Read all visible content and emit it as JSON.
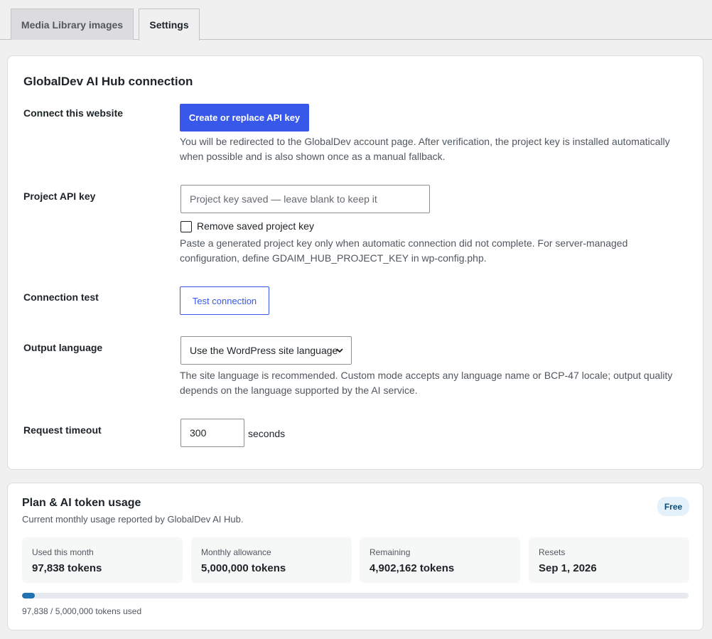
{
  "tabs": [
    {
      "label": "Media Library images",
      "active": false
    },
    {
      "label": "Settings",
      "active": true
    }
  ],
  "connection": {
    "title": "GlobalDev AI Hub connection",
    "connect_label": "Connect this website",
    "connect_button": "Create or replace API key",
    "connect_desc_line1": "You will be redirected to the GlobalDev account page. After verification, the project key is installed automatically",
    "connect_desc_line2": "when possible and is also shown once as a manual fallback.",
    "api_key_label": "Project API key",
    "api_key_placeholder": "Project key saved — leave blank to keep it",
    "api_key_value": "",
    "remove_key_label": "Remove saved project key",
    "remove_key_checked": false,
    "api_key_desc_line1": "Paste a generated project key only when automatic connection did not complete. For server-managed",
    "api_key_desc_line2": "configuration, define GDAIM_HUB_PROJECT_KEY in wp-config.php.",
    "test_label": "Connection test",
    "test_button": "Test connection",
    "language_label": "Output language",
    "language_selected": "Use the WordPress site language",
    "language_desc_line1": "The site language is recommended. Custom mode accepts any language name or BCP-47 locale; output quality",
    "language_desc_line2": "depends on the language supported by the AI service.",
    "timeout_label": "Request timeout",
    "timeout_value": "300",
    "timeout_unit": "seconds"
  },
  "usage": {
    "title": "Plan & AI token usage",
    "subtitle": "Current monthly usage reported by GlobalDev AI Hub.",
    "plan_badge": "Free",
    "stats": [
      {
        "label": "Used this month",
        "value": "97,838 tokens"
      },
      {
        "label": "Monthly allowance",
        "value": "5,000,000 tokens"
      },
      {
        "label": "Remaining",
        "value": "4,902,162 tokens"
      },
      {
        "label": "Resets",
        "value": "Sep 1, 2026"
      }
    ],
    "progress_fraction": 0.0196,
    "progress_text": "97,838 / 5,000,000 tokens used"
  },
  "colors": {
    "primary": "#3858e9",
    "progress": "#2271b1",
    "badge_bg": "#e5f1fa"
  }
}
